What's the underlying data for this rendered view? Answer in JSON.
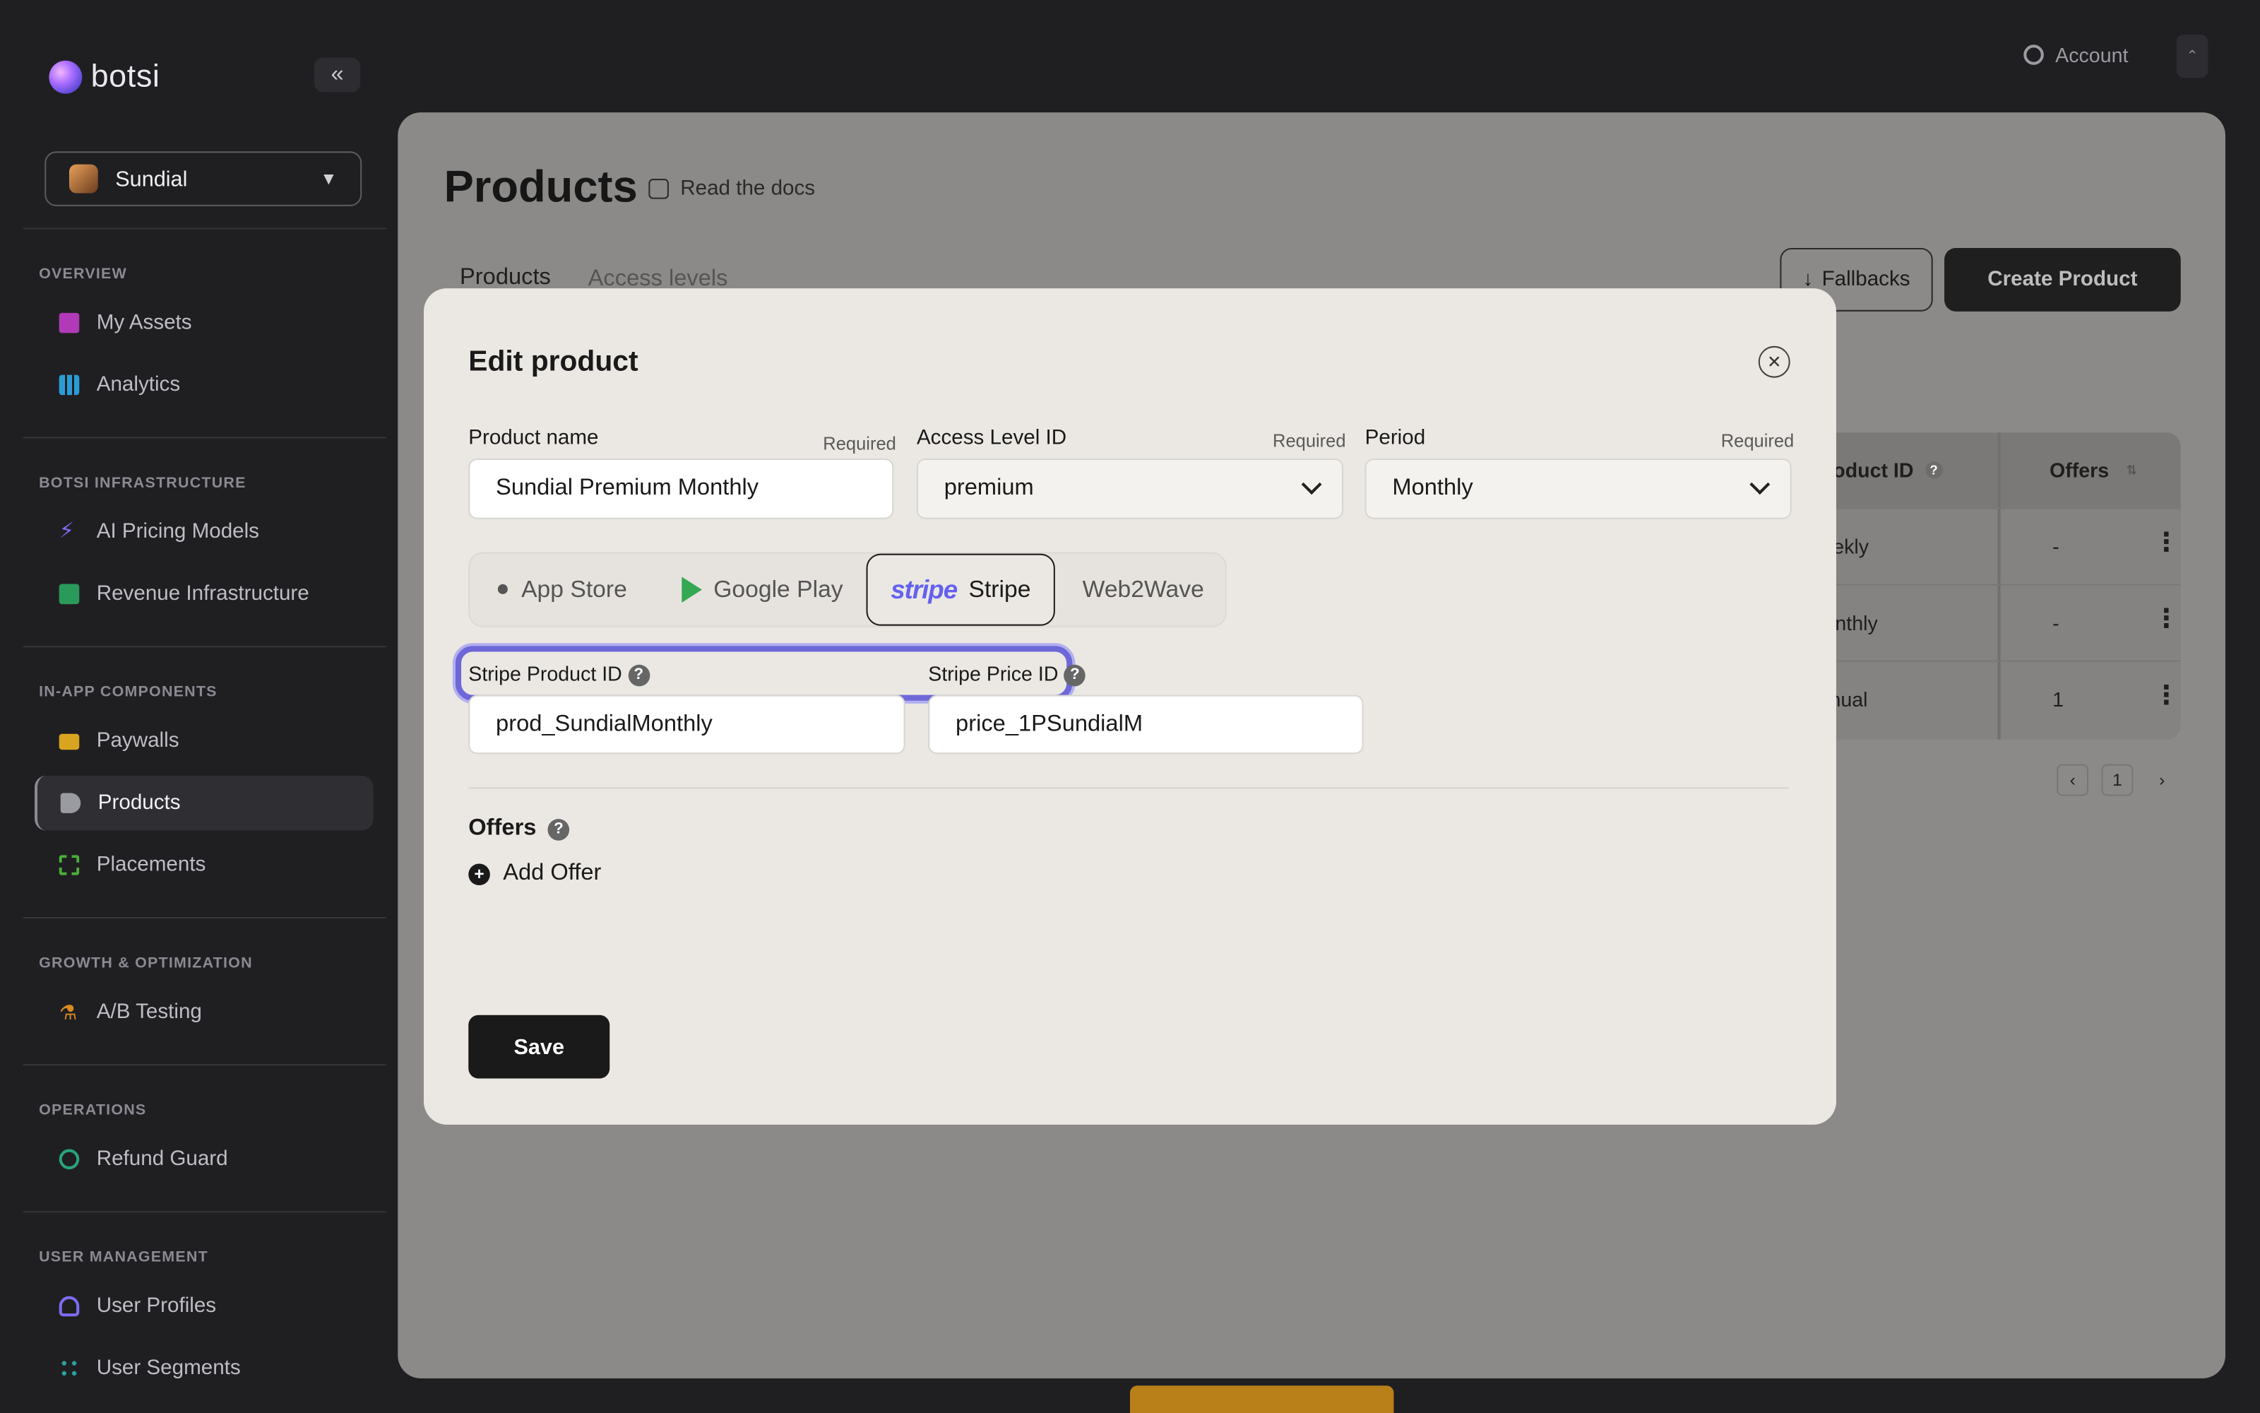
{
  "brand": {
    "name": "botsi"
  },
  "org": {
    "name": "Sundial"
  },
  "sidebar": {
    "sections": [
      {
        "label": "OVERVIEW",
        "items": [
          {
            "label": "My Assets"
          },
          {
            "label": "Analytics"
          }
        ]
      },
      {
        "label": "BOTSI INFRASTRUCTURE",
        "items": [
          {
            "label": "AI Pricing Models"
          },
          {
            "label": "Revenue Infrastructure"
          }
        ]
      },
      {
        "label": "IN-APP COMPONENTS",
        "items": [
          {
            "label": "Paywalls"
          },
          {
            "label": "Products"
          },
          {
            "label": "Placements"
          }
        ]
      },
      {
        "label": "GROWTH & OPTIMIZATION",
        "items": [
          {
            "label": "A/B Testing"
          }
        ]
      },
      {
        "label": "OPERATIONS",
        "items": [
          {
            "label": "Refund Guard"
          }
        ]
      },
      {
        "label": "USER MANAGEMENT",
        "items": [
          {
            "label": "User Profiles"
          },
          {
            "label": "User Segments"
          }
        ]
      }
    ],
    "active_item": "Products"
  },
  "topbar": {
    "account_label": "Account"
  },
  "page": {
    "title": "Products",
    "docs_link": "Read the docs",
    "tabs": [
      {
        "label": "Products"
      },
      {
        "label": "Access levels"
      }
    ],
    "fallbacks_label": "Fallbacks",
    "create_label": "Create Product",
    "table": {
      "headers": {
        "product_id": "e product ID",
        "offers": "Offers"
      },
      "rows": [
        {
          "product_id": "_weekly",
          "offers": "-"
        },
        {
          "product_id": "_monthly",
          "offers": "-"
        },
        {
          "product_id": "_annual",
          "offers": "1"
        }
      ],
      "page": "1"
    }
  },
  "modal": {
    "title": "Edit product",
    "required_label": "Required",
    "product_name": {
      "label": "Product name",
      "value": "Sundial Premium Monthly"
    },
    "access_level": {
      "label": "Access Level ID",
      "value": "premium"
    },
    "period": {
      "label": "Period",
      "value": "Monthly"
    },
    "stores": [
      {
        "label": "App Store"
      },
      {
        "label": "Google Play"
      },
      {
        "label": "Stripe",
        "logo_text": "stripe"
      },
      {
        "label": "Web2Wave"
      }
    ],
    "active_store": "Stripe",
    "stripe_product_id": {
      "label": "Stripe Product ID",
      "value": "prod_SundialMonthly"
    },
    "stripe_price_id": {
      "label": "Stripe Price ID",
      "value": "price_1PSundialM"
    },
    "offers": {
      "label": "Offers",
      "add_label": "Add Offer"
    },
    "save_label": "Save"
  },
  "colors": {
    "accent": "#6461ef",
    "highlight": "#6d67d8",
    "dark": "#1f1f22"
  }
}
